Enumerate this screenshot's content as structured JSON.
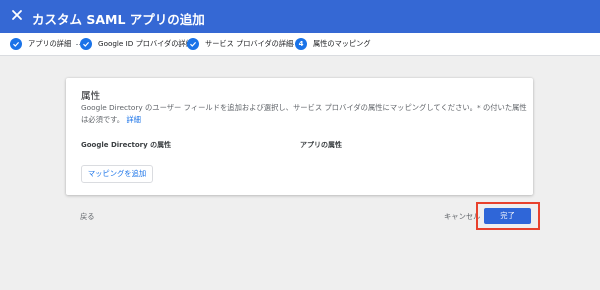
{
  "header": {
    "title": "カスタム SAML アプリの追加",
    "close_icon": "close-icon"
  },
  "steps": [
    {
      "label": "アプリの詳細",
      "state": "done"
    },
    {
      "label": "Google ID プロバイダの詳細",
      "state": "done"
    },
    {
      "label": "サービス プロバイダの詳細",
      "state": "done"
    },
    {
      "label": "属性のマッピング",
      "state": "current",
      "number": "4"
    }
  ],
  "card": {
    "title": "属性",
    "description": "Google Directory のユーザー フィールドを追加および選択し、サービス プロバイダの属性にマッピングしてください。* の付いた属性は必須です。",
    "link": "詳細",
    "col_left": "Google Directory の属性",
    "col_right": "アプリの属性",
    "add_mapping_label": "マッピングを追加"
  },
  "footer": {
    "back_label": "戻る",
    "cancel_label": "キャンセル",
    "done_label": "完了"
  },
  "colors": {
    "header": "#3568d4",
    "accent": "#1a73e8",
    "highlight": "#e8412c"
  }
}
